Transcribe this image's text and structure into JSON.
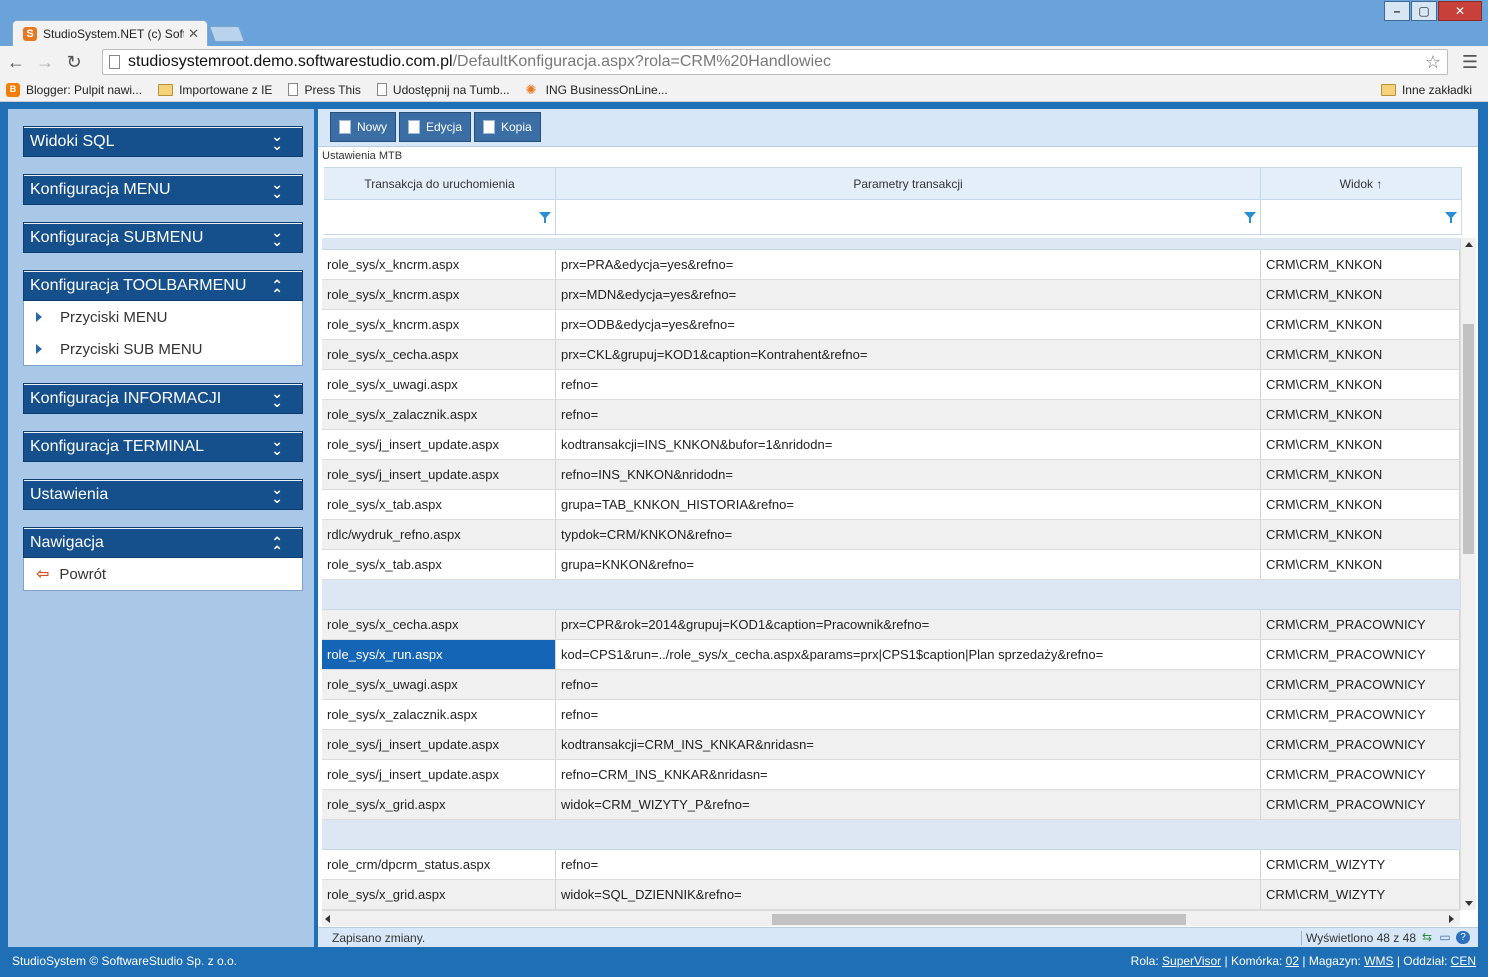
{
  "browser": {
    "tab_title": "StudioSystem.NET (c) Soft",
    "tab_favicon": "S",
    "url_host": "studiosystemroot.demo.softwarestudio.com.pl",
    "url_path": "/DefaultKonfiguracja.aspx?rola=CRM%20Handlowiec",
    "bookmarks": [
      {
        "label": "Blogger: Pulpit nawi...",
        "icon": "blogger-icon"
      },
      {
        "label": "Importowane z IE",
        "icon": "folder-icon"
      },
      {
        "label": "Press This",
        "icon": "page-icon"
      },
      {
        "label": "Udostępnij na Tumb...",
        "icon": "page-icon"
      },
      {
        "label": "ING BusinessOnLine...",
        "icon": "ing-icon"
      }
    ],
    "other_bookmarks": "Inne zakładki"
  },
  "sidebar": {
    "panels": [
      {
        "title": "Widoki SQL",
        "expanded": false,
        "items": []
      },
      {
        "title": "Konfiguracja MENU",
        "expanded": false,
        "items": []
      },
      {
        "title": "Konfiguracja SUBMENU",
        "expanded": false,
        "items": []
      },
      {
        "title": "Konfiguracja TOOLBARMENU",
        "expanded": true,
        "items": [
          "Przyciski MENU",
          "Przyciski SUB MENU"
        ]
      },
      {
        "title": "Konfiguracja INFORMACJI",
        "expanded": false,
        "items": []
      },
      {
        "title": "Konfiguracja TERMINAL",
        "expanded": false,
        "items": []
      },
      {
        "title": "Ustawienia",
        "expanded": false,
        "items": []
      },
      {
        "title": "Nawigacja",
        "expanded": true,
        "items": [
          "Powrót"
        ]
      }
    ]
  },
  "toolbar": {
    "new_label": "Nowy",
    "edit_label": "Edycja",
    "copy_label": "Kopia"
  },
  "grid": {
    "caption": "Ustawienia MTB",
    "columns": [
      "Transakcja do uruchomienia",
      "Parametry transakcji",
      "Widok ↑"
    ],
    "rows": [
      {
        "type": "group-thin"
      },
      {
        "t": "role_sys/x_kncrm.aspx",
        "p": "prx=PRA&edycja=yes&refno=",
        "w": "CRM\\CRM_KNKON"
      },
      {
        "t": "role_sys/x_kncrm.aspx",
        "p": "prx=MDN&edycja=yes&refno=",
        "w": "CRM\\CRM_KNKON"
      },
      {
        "t": "role_sys/x_kncrm.aspx",
        "p": "prx=ODB&edycja=yes&refno=",
        "w": "CRM\\CRM_KNKON"
      },
      {
        "t": "role_sys/x_cecha.aspx",
        "p": "prx=CKL&grupuj=KOD1&caption=Kontrahent&refno=",
        "w": "CRM\\CRM_KNKON"
      },
      {
        "t": "role_sys/x_uwagi.aspx",
        "p": "refno=",
        "w": "CRM\\CRM_KNKON"
      },
      {
        "t": "role_sys/x_zalacznik.aspx",
        "p": "refno=",
        "w": "CRM\\CRM_KNKON"
      },
      {
        "t": "role_sys/j_insert_update.aspx",
        "p": " kodtransakcji=INS_KNKON&bufor=1&nridodn=",
        "w": "CRM\\CRM_KNKON"
      },
      {
        "t": "role_sys/j_insert_update.aspx",
        "p": "refno=INS_KNKON&nridodn=",
        "w": "CRM\\CRM_KNKON"
      },
      {
        "t": "role_sys/x_tab.aspx",
        "p": "grupa=TAB_KNKON_HISTORIA&refno=",
        "w": "CRM\\CRM_KNKON"
      },
      {
        "t": "rdlc/wydruk_refno.aspx",
        "p": "typdok=CRM/KNKON&refno=",
        "w": "CRM\\CRM_KNKON"
      },
      {
        "t": "role_sys/x_tab.aspx",
        "p": "grupa=KNKON&refno=",
        "w": "CRM\\CRM_KNKON"
      },
      {
        "type": "group"
      },
      {
        "t": "role_sys/x_cecha.aspx",
        "p": "prx=CPR&rok=2014&grupuj=KOD1&caption=Pracownik&refno=",
        "w": "CRM\\CRM_PRACOWNICY"
      },
      {
        "t": "role_sys/x_run.aspx",
        "p": "kod=CPS1&run=../role_sys/x_cecha.aspx&params=prx|CPS1$caption|Plan sprzedaży&refno=",
        "w": "CRM\\CRM_PRACOWNICY",
        "selected": true
      },
      {
        "t": "role_sys/x_uwagi.aspx",
        "p": "refno=",
        "w": "CRM\\CRM_PRACOWNICY"
      },
      {
        "t": "role_sys/x_zalacznik.aspx",
        "p": "refno=",
        "w": "CRM\\CRM_PRACOWNICY"
      },
      {
        "t": "role_sys/j_insert_update.aspx",
        "p": " kodtransakcji=CRM_INS_KNKAR&nridasn=",
        "w": "CRM\\CRM_PRACOWNICY"
      },
      {
        "t": "role_sys/j_insert_update.aspx",
        "p": "refno=CRM_INS_KNKAR&nridasn=",
        "w": "CRM\\CRM_PRACOWNICY"
      },
      {
        "t": "role_sys/x_grid.aspx",
        "p": "widok=CRM_WIZYTY_P&refno=",
        "w": "CRM\\CRM_PRACOWNICY"
      },
      {
        "type": "group"
      },
      {
        "t": "role_crm/dpcrm_status.aspx",
        "p": "refno=",
        "w": "CRM\\CRM_WIZYTY"
      },
      {
        "t": "role_sys/x_grid.aspx",
        "p": "widok=SQL_DZIENNIK&refno=",
        "w": "CRM\\CRM_WIZYTY"
      }
    ]
  },
  "status": {
    "message": "Zapisano zmiany.",
    "count": "Wyświetlono 48 z 48"
  },
  "footer": {
    "copyright": "StudioSystem © SoftwareStudio Sp. z o.o.",
    "role_label": "Rola: ",
    "role_value": "SuperVisor",
    "cell_label": " | Komórka: ",
    "cell_value": "02",
    "warehouse_label": " | Magazyn: ",
    "warehouse_value": "WMS",
    "branch_label": " | Oddział: ",
    "branch_value": "CEN"
  }
}
